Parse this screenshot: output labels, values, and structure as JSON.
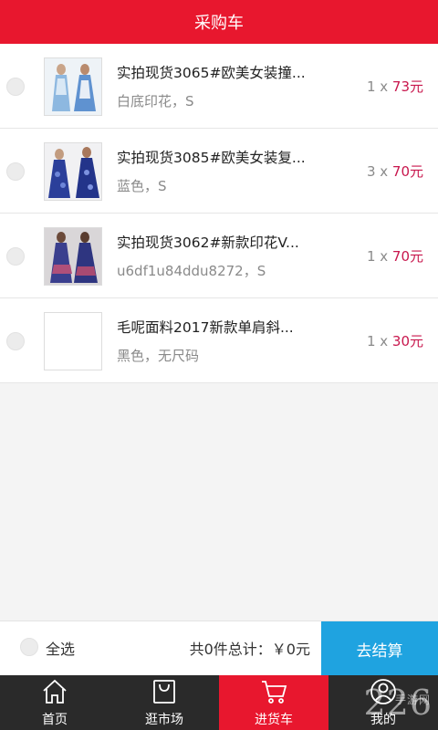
{
  "header": {
    "title": "采购车"
  },
  "cart": {
    "items": [
      {
        "title": "实拍现货3065#欧美女装撞...",
        "spec": "白底印花，S",
        "qty": "1 x ",
        "price": "73元",
        "thumb": "dress-photo-light-blue"
      },
      {
        "title": "实拍现货3085#欧美女装复...",
        "spec": "蓝色，S",
        "qty": "3 x ",
        "price": "70元",
        "thumb": "dress-photo-blue-floral"
      },
      {
        "title": "实拍现货3062#新款印花V...",
        "spec": "u6df1u84ddu8272，S",
        "qty": "1 x ",
        "price": "70元",
        "thumb": "dress-photo-blue-print"
      },
      {
        "title": "毛呢面料2017新款单肩斜...",
        "spec": "黑色，无尺码",
        "qty": "1 x ",
        "price": "30元",
        "thumb": "empty"
      }
    ]
  },
  "footer": {
    "select_all": "全选",
    "total": "共0件总计：￥0元",
    "checkout": "去结算"
  },
  "tabbar": {
    "items": [
      {
        "label": "首页",
        "icon": "home-icon"
      },
      {
        "label": "逛市场",
        "icon": "shopping-bag-icon"
      },
      {
        "label": "进货车",
        "icon": "cart-icon"
      },
      {
        "label": "我的",
        "icon": "user-icon"
      }
    ]
  },
  "watermark": {
    "text": "226",
    "sub": "手游网"
  },
  "colors": {
    "brand_red": "#e8172e",
    "checkout_blue": "#1fa3e0",
    "price": "#c8174d",
    "tabbar_bg": "#2a2a2a"
  }
}
